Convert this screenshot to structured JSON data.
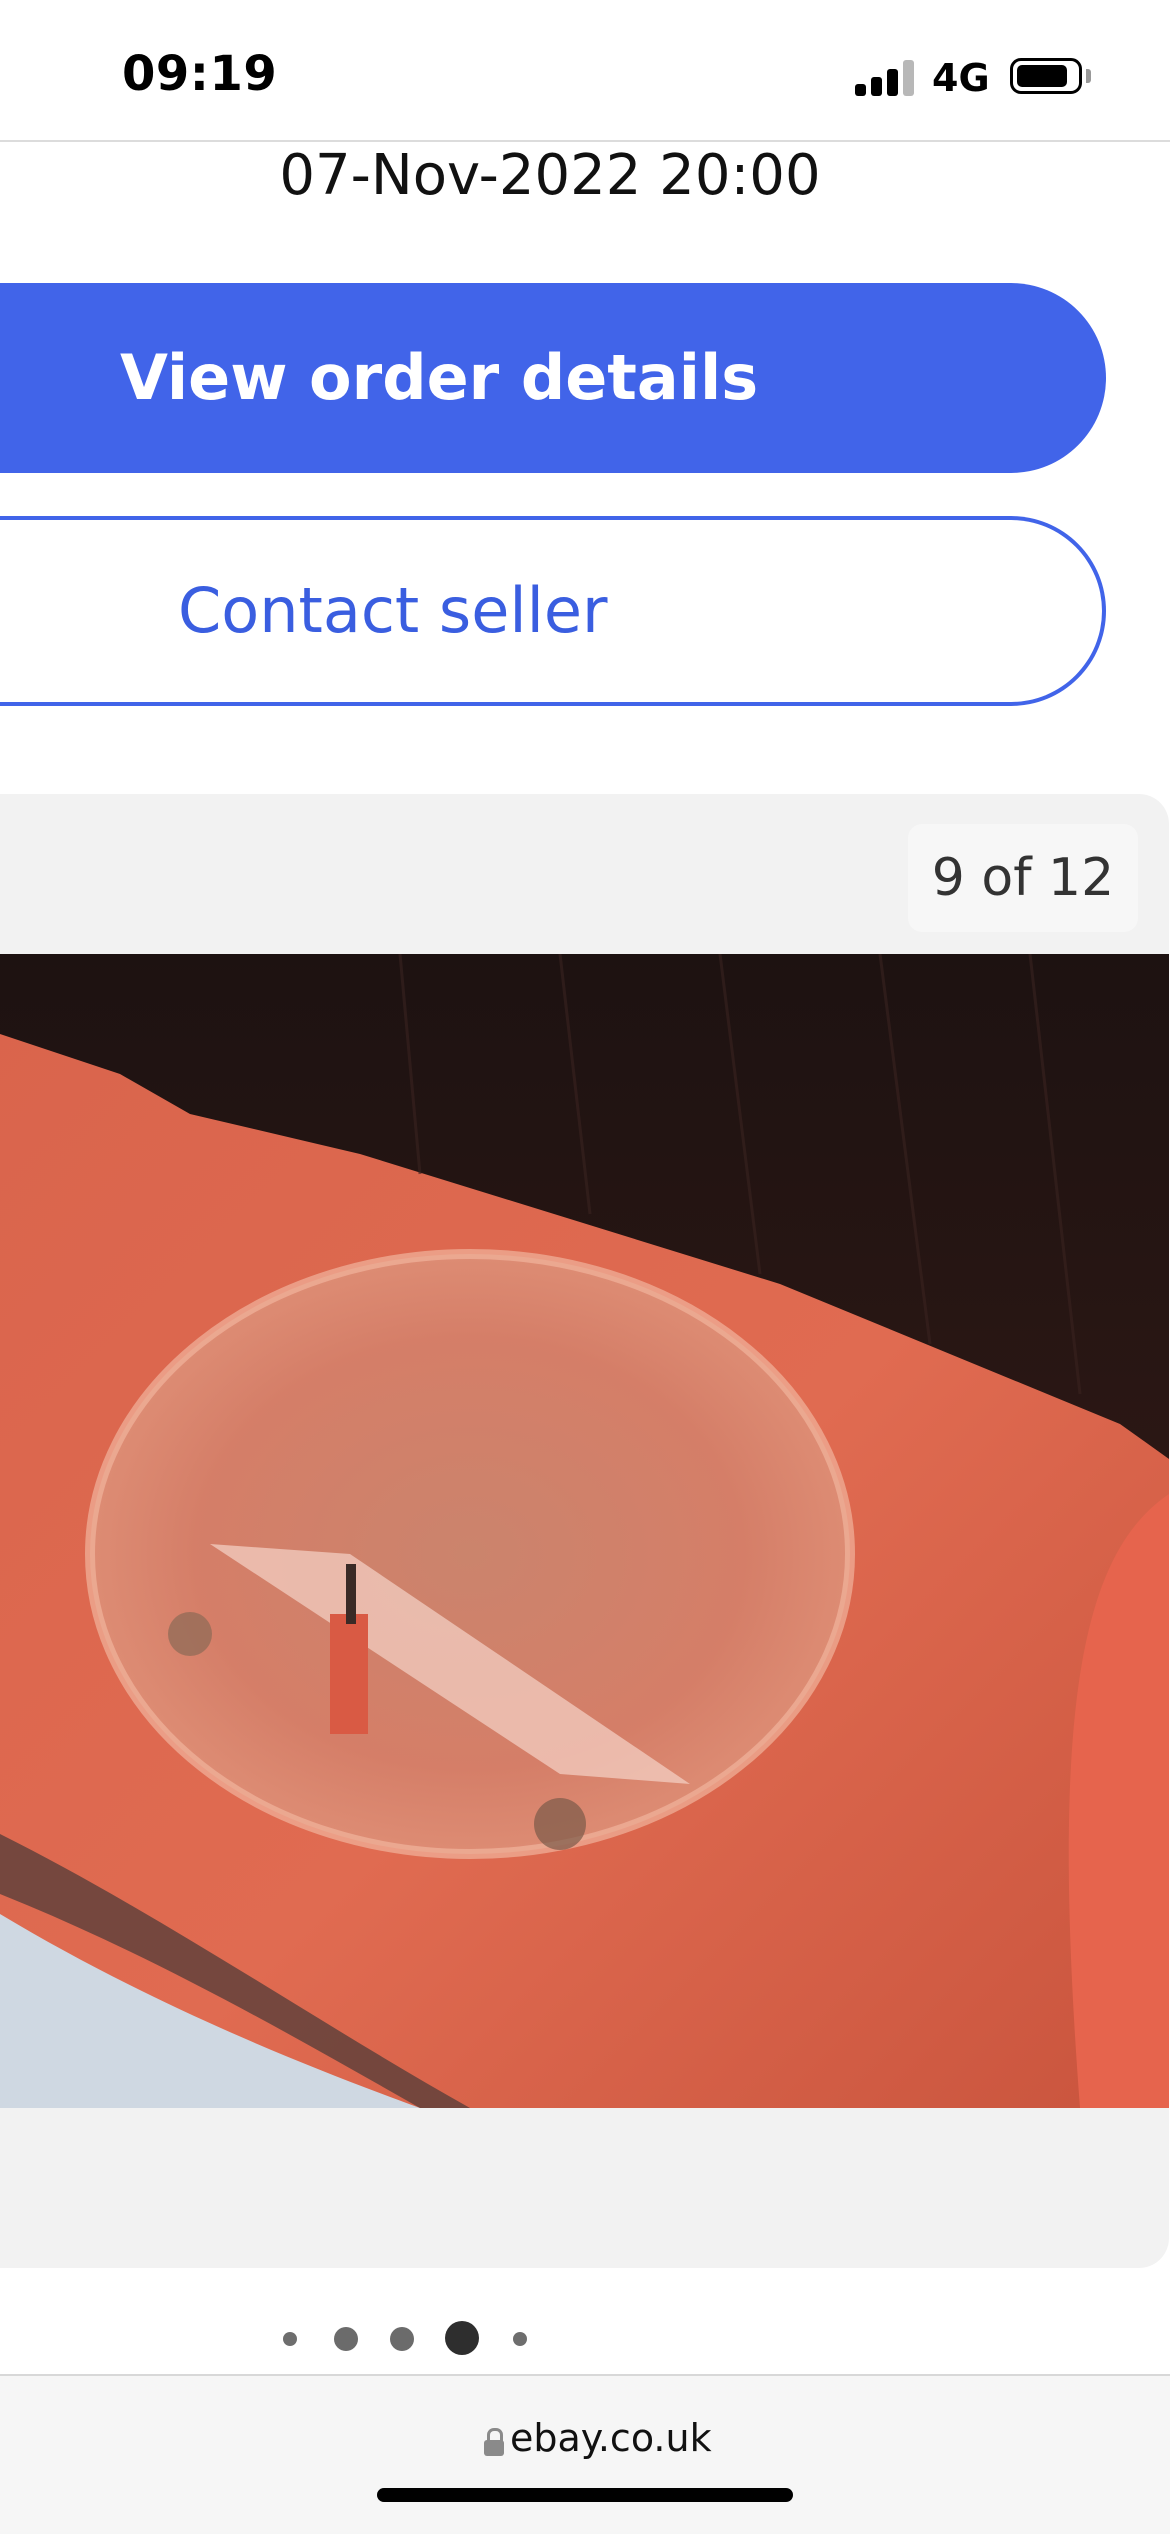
{
  "status_bar": {
    "time": "09:19",
    "network": "4G",
    "icons": [
      "signal-icon",
      "battery-icon"
    ]
  },
  "order": {
    "date": "07-Nov-2022 20:00"
  },
  "actions": {
    "view_order_label": "View order details",
    "contact_seller_label": "Contact seller"
  },
  "gallery": {
    "counter": "9 of 12",
    "image_description": "photo",
    "page_count": 5,
    "active_page": 4
  },
  "browser": {
    "url": "ebay.co.uk",
    "lock_icon": "lock-icon"
  },
  "colors": {
    "accent": "#4164e9",
    "gallery_bg": "#f2f2f2"
  }
}
